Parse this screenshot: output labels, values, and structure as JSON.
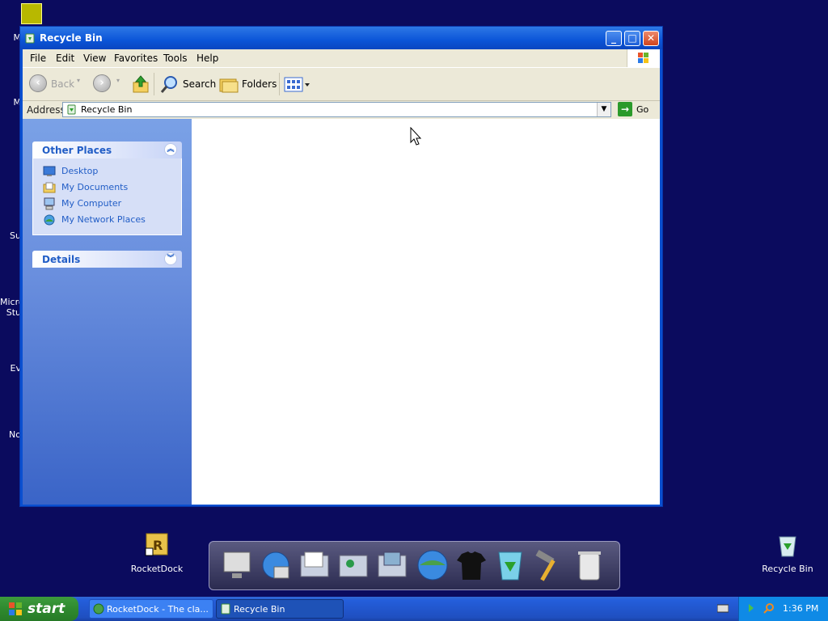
{
  "window": {
    "title": "Recycle Bin",
    "buttons": {
      "minimize": "_",
      "maximize": "□",
      "close": "✕"
    }
  },
  "menu": [
    "File",
    "Edit",
    "View",
    "Favorites",
    "Tools",
    "Help"
  ],
  "toolbar": {
    "back": "Back",
    "search": "Search",
    "folders": "Folders"
  },
  "address": {
    "label": "Address",
    "value": "Recycle Bin",
    "go": "Go"
  },
  "taskpane": {
    "other_places": {
      "title": "Other Places",
      "items": [
        "Desktop",
        "My Documents",
        "My Computer",
        "My Network Places"
      ]
    },
    "details": {
      "title": "Details"
    }
  },
  "desktop": {
    "icons": {
      "rocketdock": "RocketDock",
      "recycle_bin": "Recycle Bin"
    },
    "left_fragments": [
      "M",
      "M",
      "Su",
      "Micro",
      "Stu",
      "Ev",
      "No"
    ]
  },
  "taskbar": {
    "start": "start",
    "tasks": [
      "RocketDock - The cla...",
      "Recycle Bin"
    ],
    "clock": "1:36 PM"
  },
  "colors": {
    "desktop_bg": "#0b0b5e",
    "titlebar": "#0b55d8",
    "taskpane_link": "#215dc6",
    "start_green": "#2f8a2f"
  }
}
